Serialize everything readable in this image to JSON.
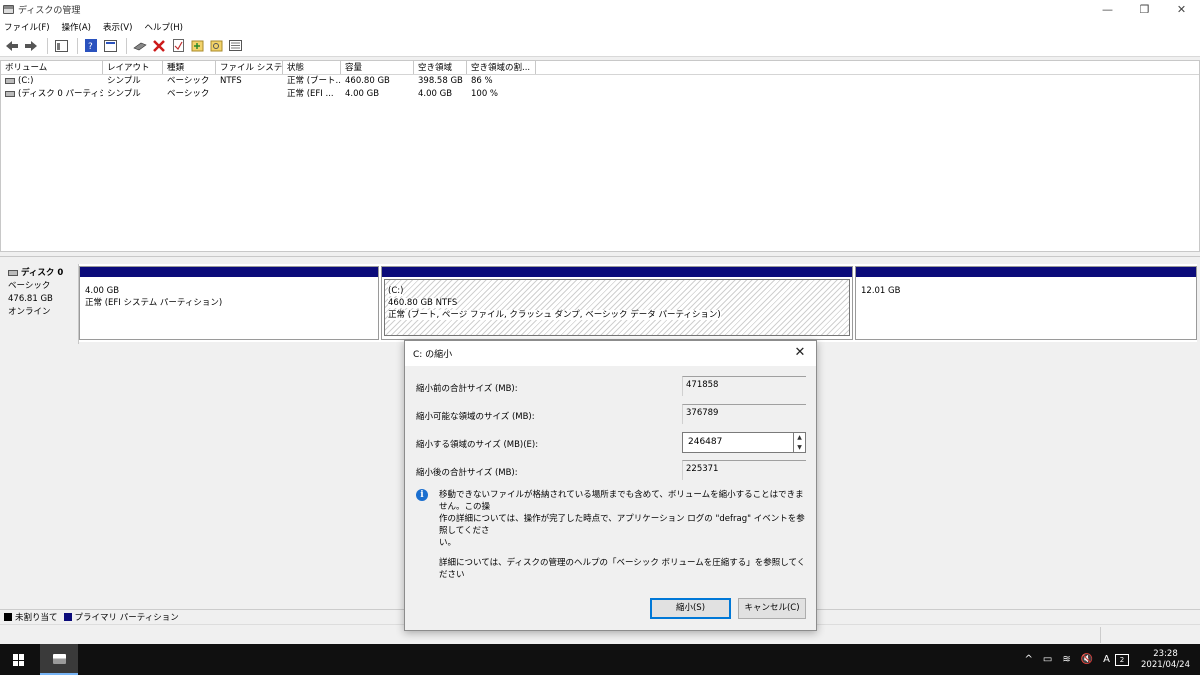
{
  "window": {
    "title": "ディスクの管理",
    "minimize": "—",
    "restore": "❐",
    "close": "✕"
  },
  "menu": [
    "ファイル(F)",
    "操作(A)",
    "表示(V)",
    "ヘルプ(H)"
  ],
  "toolbar": {
    "icons": [
      "back-arrow-icon",
      "forward-arrow-icon",
      "view-icon",
      "help-icon",
      "properties-icon",
      "disk-icon",
      "delete-icon",
      "check-icon",
      "folder-add-icon",
      "folder-search-icon",
      "list-icon"
    ],
    "delete_color": "#cc1a1a"
  },
  "volumes": {
    "columns": [
      "ボリューム",
      "レイアウト",
      "種類",
      "ファイル システム",
      "状態",
      "容量",
      "空き領域",
      "空き領域の割..."
    ],
    "rows": [
      [
        "(C:)",
        "シンプル",
        "ベーシック",
        "NTFS",
        "正常 (ブート...",
        "460.80 GB",
        "398.58 GB",
        "86 %"
      ],
      [
        "(ディスク 0 パーティショ...",
        "シンプル",
        "ベーシック",
        "",
        "正常 (EFI ...",
        "4.00 GB",
        "4.00 GB",
        "100 %"
      ]
    ]
  },
  "disk": {
    "name": "ディスク 0",
    "type": "ベーシック",
    "size": "476.81 GB",
    "status": "オンライン",
    "partitions": [
      {
        "name": "",
        "size": "4.00 GB",
        "status": "正常 (EFI システム パーティション)"
      },
      {
        "name": "(C:)",
        "size": "460.80 GB NTFS",
        "status": "正常 (ブート, ページ ファイル, クラッシュ ダンプ, ベーシック データ パーティション)"
      },
      {
        "name": "",
        "size": "12.01 GB",
        "status": ""
      }
    ]
  },
  "legend": {
    "unallocated": "未割り当て",
    "primary": "プライマリ パーティション",
    "unallocated_color": "#000000",
    "primary_color": "#0b0b7a"
  },
  "dialog": {
    "title": "C: の縮小",
    "close": "✕",
    "labels": {
      "total_before": "縮小前の合計サイズ (MB):",
      "available": "縮小可能な領域のサイズ (MB):",
      "shrink_amount": "縮小する領域のサイズ (MB)(E):",
      "total_after": "縮小後の合計サイズ (MB):"
    },
    "values": {
      "total_before": "471858",
      "available": "376789",
      "shrink_amount": "246487",
      "total_after": "225371"
    },
    "spin_up": "▲",
    "spin_down": "▼",
    "info_icon": "i",
    "info_line1": "移動できないファイルが格納されている場所までも含めて、ボリュームを縮小することはできません。この操",
    "info_line2": "作の詳細については、操作が完了した時点で、アプリケーション ログの \"defrag\" イベントを参照してくださ",
    "info_line3": "い。",
    "help_text": "詳細については、ディスクの管理のヘルプの「ベーシック ボリュームを圧縮する」を参照してください",
    "ok": "縮小(S)",
    "cancel": "キャンセル(C)"
  },
  "taskbar": {
    "tray": [
      "^",
      "▭",
      "≋",
      "🔇",
      "A"
    ],
    "time": "23:28",
    "date": "2021/04/24",
    "notification": "2"
  }
}
